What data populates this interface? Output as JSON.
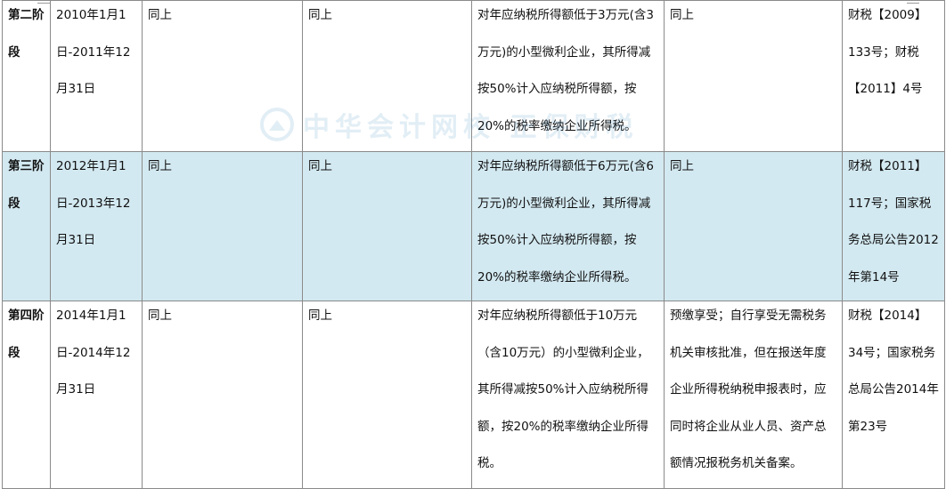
{
  "watermark": {
    "text": "中华会计网校 正保财税"
  },
  "rows": [
    {
      "stage": "第二阶段",
      "period": "2010年1月1日-2011年12月31日",
      "col3": "同上",
      "col4": "同上",
      "policy": "对年应纳税所得额低于3万元(含3万元)的小型微利企业，其所得减按50%计入应纳税所得额，按20%的税率缴纳企业所得税。",
      "procedure": "同上",
      "doc": "财税【2009】133号；财税【2011】4号"
    },
    {
      "stage": "第三阶段",
      "period": "2012年1月1日-2013年12月31日",
      "col3": "同上",
      "col4": "同上",
      "policy": "对年应纳税所得额低于6万元(含6万元)的小型微利企业，其所得减按50%计入应纳税所得额，按20%的税率缴纳企业所得税。",
      "procedure": "同上",
      "doc": "财税【2011】117号；国家税务总局公告2012年第14号"
    },
    {
      "stage": "第四阶段",
      "period": "2014年1月1日-2014年12月31日",
      "col3": "同上",
      "col4": "同上",
      "policy": "对年应纳税所得额低于10万元（含10万元）的小型微利企业，其所得减按50%计入应纳税所得额，按20%的税率缴纳企业所得税。",
      "procedure": "预缴享受；自行享受无需税务机关审核批准，但在报送年度企业所得税纳税申报表时，应同时将企业从业人员、资产总额情况报税务机关备案。",
      "doc": "财税【2014】34号；国家税务总局公告2014年第23号"
    }
  ]
}
